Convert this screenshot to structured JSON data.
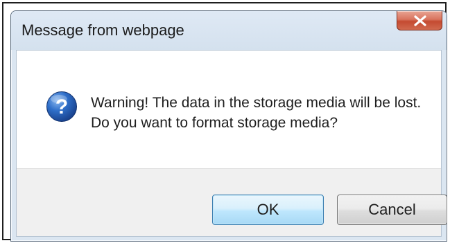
{
  "window": {
    "title": "Message from webpage",
    "close_icon": "close-icon"
  },
  "message": {
    "icon": "question-icon",
    "lines": [
      "Warning! The data in the storage media will be lost.",
      "Do you want to format storage media?"
    ]
  },
  "buttons": {
    "ok_label": "OK",
    "cancel_label": "Cancel"
  },
  "colors": {
    "close_button": "#c44a31",
    "question_icon": "#1f5cb3",
    "ok_border": "#3c7fb1"
  }
}
